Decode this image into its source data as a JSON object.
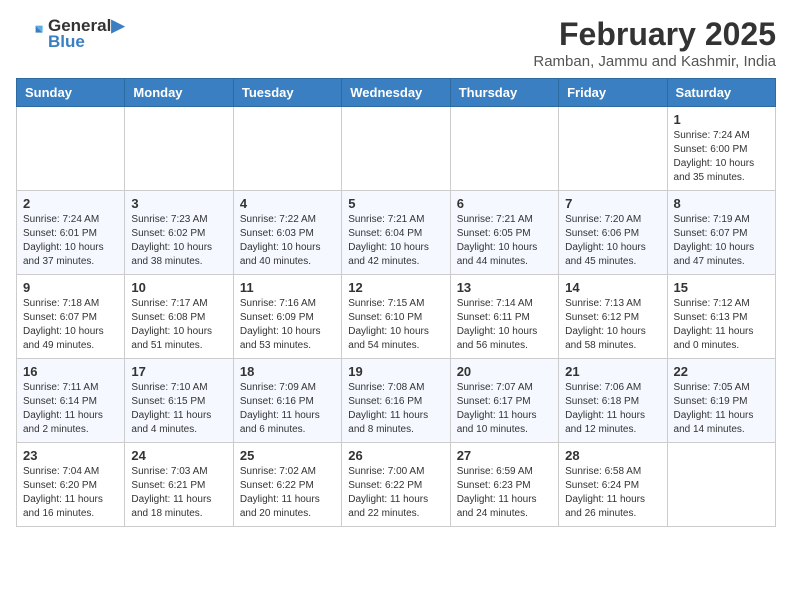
{
  "header": {
    "logo_line1": "General",
    "logo_line2": "Blue",
    "month_year": "February 2025",
    "location": "Ramban, Jammu and Kashmir, India"
  },
  "weekdays": [
    "Sunday",
    "Monday",
    "Tuesday",
    "Wednesday",
    "Thursday",
    "Friday",
    "Saturday"
  ],
  "weeks": [
    [
      {
        "day": "",
        "info": ""
      },
      {
        "day": "",
        "info": ""
      },
      {
        "day": "",
        "info": ""
      },
      {
        "day": "",
        "info": ""
      },
      {
        "day": "",
        "info": ""
      },
      {
        "day": "",
        "info": ""
      },
      {
        "day": "1",
        "info": "Sunrise: 7:24 AM\nSunset: 6:00 PM\nDaylight: 10 hours and 35 minutes."
      }
    ],
    [
      {
        "day": "2",
        "info": "Sunrise: 7:24 AM\nSunset: 6:01 PM\nDaylight: 10 hours and 37 minutes."
      },
      {
        "day": "3",
        "info": "Sunrise: 7:23 AM\nSunset: 6:02 PM\nDaylight: 10 hours and 38 minutes."
      },
      {
        "day": "4",
        "info": "Sunrise: 7:22 AM\nSunset: 6:03 PM\nDaylight: 10 hours and 40 minutes."
      },
      {
        "day": "5",
        "info": "Sunrise: 7:21 AM\nSunset: 6:04 PM\nDaylight: 10 hours and 42 minutes."
      },
      {
        "day": "6",
        "info": "Sunrise: 7:21 AM\nSunset: 6:05 PM\nDaylight: 10 hours and 44 minutes."
      },
      {
        "day": "7",
        "info": "Sunrise: 7:20 AM\nSunset: 6:06 PM\nDaylight: 10 hours and 45 minutes."
      },
      {
        "day": "8",
        "info": "Sunrise: 7:19 AM\nSunset: 6:07 PM\nDaylight: 10 hours and 47 minutes."
      }
    ],
    [
      {
        "day": "9",
        "info": "Sunrise: 7:18 AM\nSunset: 6:07 PM\nDaylight: 10 hours and 49 minutes."
      },
      {
        "day": "10",
        "info": "Sunrise: 7:17 AM\nSunset: 6:08 PM\nDaylight: 10 hours and 51 minutes."
      },
      {
        "day": "11",
        "info": "Sunrise: 7:16 AM\nSunset: 6:09 PM\nDaylight: 10 hours and 53 minutes."
      },
      {
        "day": "12",
        "info": "Sunrise: 7:15 AM\nSunset: 6:10 PM\nDaylight: 10 hours and 54 minutes."
      },
      {
        "day": "13",
        "info": "Sunrise: 7:14 AM\nSunset: 6:11 PM\nDaylight: 10 hours and 56 minutes."
      },
      {
        "day": "14",
        "info": "Sunrise: 7:13 AM\nSunset: 6:12 PM\nDaylight: 10 hours and 58 minutes."
      },
      {
        "day": "15",
        "info": "Sunrise: 7:12 AM\nSunset: 6:13 PM\nDaylight: 11 hours and 0 minutes."
      }
    ],
    [
      {
        "day": "16",
        "info": "Sunrise: 7:11 AM\nSunset: 6:14 PM\nDaylight: 11 hours and 2 minutes."
      },
      {
        "day": "17",
        "info": "Sunrise: 7:10 AM\nSunset: 6:15 PM\nDaylight: 11 hours and 4 minutes."
      },
      {
        "day": "18",
        "info": "Sunrise: 7:09 AM\nSunset: 6:16 PM\nDaylight: 11 hours and 6 minutes."
      },
      {
        "day": "19",
        "info": "Sunrise: 7:08 AM\nSunset: 6:16 PM\nDaylight: 11 hours and 8 minutes."
      },
      {
        "day": "20",
        "info": "Sunrise: 7:07 AM\nSunset: 6:17 PM\nDaylight: 11 hours and 10 minutes."
      },
      {
        "day": "21",
        "info": "Sunrise: 7:06 AM\nSunset: 6:18 PM\nDaylight: 11 hours and 12 minutes."
      },
      {
        "day": "22",
        "info": "Sunrise: 7:05 AM\nSunset: 6:19 PM\nDaylight: 11 hours and 14 minutes."
      }
    ],
    [
      {
        "day": "23",
        "info": "Sunrise: 7:04 AM\nSunset: 6:20 PM\nDaylight: 11 hours and 16 minutes."
      },
      {
        "day": "24",
        "info": "Sunrise: 7:03 AM\nSunset: 6:21 PM\nDaylight: 11 hours and 18 minutes."
      },
      {
        "day": "25",
        "info": "Sunrise: 7:02 AM\nSunset: 6:22 PM\nDaylight: 11 hours and 20 minutes."
      },
      {
        "day": "26",
        "info": "Sunrise: 7:00 AM\nSunset: 6:22 PM\nDaylight: 11 hours and 22 minutes."
      },
      {
        "day": "27",
        "info": "Sunrise: 6:59 AM\nSunset: 6:23 PM\nDaylight: 11 hours and 24 minutes."
      },
      {
        "day": "28",
        "info": "Sunrise: 6:58 AM\nSunset: 6:24 PM\nDaylight: 11 hours and 26 minutes."
      },
      {
        "day": "",
        "info": ""
      }
    ]
  ]
}
